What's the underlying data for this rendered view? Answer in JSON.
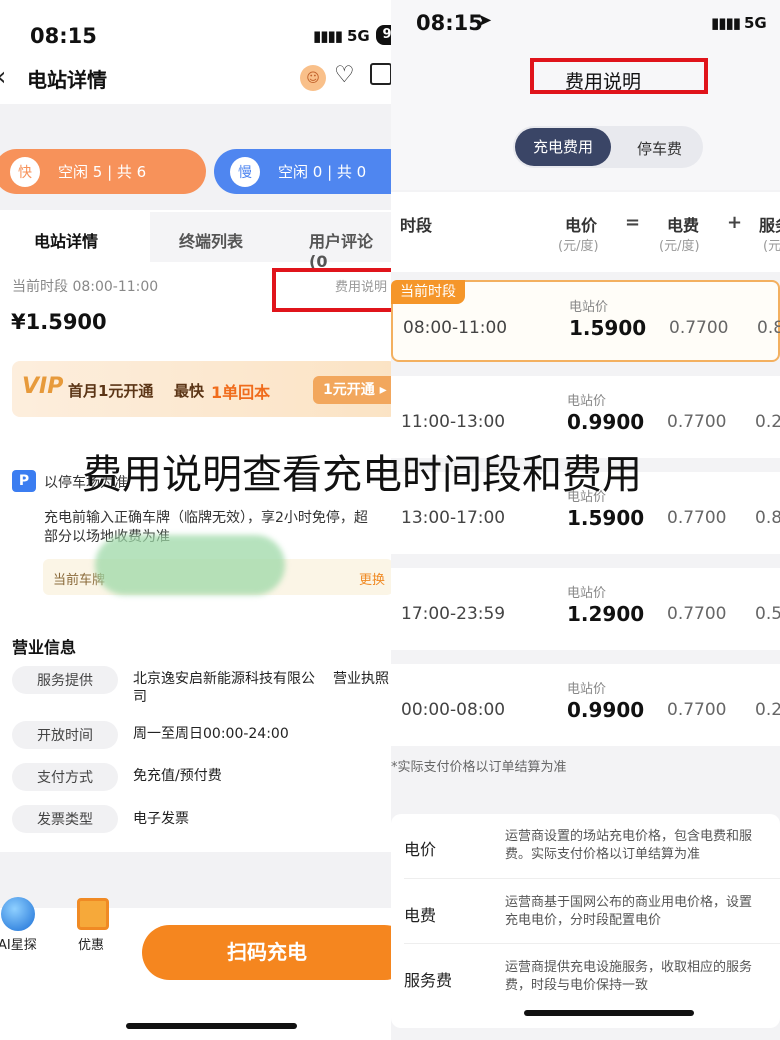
{
  "left": {
    "status": {
      "time": "08:15",
      "network": "5G",
      "battery": "9"
    },
    "nav": {
      "title": "电站详情"
    },
    "fast": {
      "badge": "快",
      "text": "空闲 5 | 共 6",
      "color": "#f7925a"
    },
    "slow": {
      "badge": "慢",
      "text": "空闲 0 | 共 0",
      "color": "#4f86f0"
    },
    "tabs": [
      "电站详情",
      "终端列表",
      "用户评论(0"
    ],
    "price": {
      "period": "当前时段 08:00-11:00",
      "link": "费用说明",
      "value": "¥1.5900"
    },
    "vip": {
      "logo": "VIP",
      "text1": "首月1元开通",
      "text2": "最快",
      "text3": "1单回本",
      "button": "1元开通 ▸"
    },
    "parking": {
      "icon": "P",
      "title": "以停车场为准",
      "desc1": "充电前输入正确车牌（临牌无效），享2小时免停，超",
      "desc2": "部分以场地收费为准",
      "plate_label": "当前车牌",
      "change": "更换"
    },
    "business": {
      "heading": "营业信息",
      "rows": [
        {
          "label": "服务提供",
          "value": "北京逸安启新能源科技有限公",
          "value2": "营业执照",
          "value_line2": "司"
        },
        {
          "label": "开放时间",
          "value": "周一至周日00:00-24:00"
        },
        {
          "label": "支付方式",
          "value": "免充值/预付费"
        },
        {
          "label": "发票类型",
          "value": "电子发票"
        }
      ]
    },
    "bottom": {
      "ai": "AI星探",
      "coupon": "优惠",
      "scan": "扫码充电"
    }
  },
  "right": {
    "status": {
      "time": "08:15",
      "network": "5G"
    },
    "title": "费用说明",
    "seg": {
      "active": "充电费用",
      "inactive": "停车费"
    },
    "header": {
      "period": "时段",
      "price": "电价",
      "price_unit": "(元/度)",
      "eq": "=",
      "fee": "电费",
      "fee_unit": "(元/度)",
      "plus": "+",
      "service": "服务",
      "service_unit": "(元"
    },
    "current_tag": "当前时段",
    "station_label": "电站价",
    "rows": [
      {
        "period": "08:00-11:00",
        "price": "1.5900",
        "fee": "0.7700",
        "service": "0.8"
      },
      {
        "period": "11:00-13:00",
        "price": "0.9900",
        "fee": "0.7700",
        "service": "0.2"
      },
      {
        "period": "13:00-17:00",
        "price": "1.5900",
        "fee": "0.7700",
        "service": "0.8"
      },
      {
        "period": "17:00-23:59",
        "price": "1.2900",
        "fee": "0.7700",
        "service": "0.5"
      },
      {
        "period": "00:00-08:00",
        "price": "0.9900",
        "fee": "0.7700",
        "service": "0.2"
      }
    ],
    "note": "*实际支付价格以订单结算为准",
    "defs": [
      {
        "term": "电价",
        "line1": "运营商设置的场站充电价格，包含电费和服",
        "line2": "费。实际支付价格以订单结算为准"
      },
      {
        "term": "电费",
        "line1": "运营商基于国网公布的商业用电价格，设置",
        "line2": "充电电价，分时段配置电价"
      },
      {
        "term": "服务费",
        "line1": "运营商提供充电设施服务，收取相应的服务",
        "line2": "费，时段与电价保持一致"
      }
    ]
  },
  "caption": "费用说明查看充电时间段和费用",
  "colors": {
    "highlight_red": "#e0141b",
    "orange": "#f08a24",
    "segment_dark": "#3a4566"
  }
}
